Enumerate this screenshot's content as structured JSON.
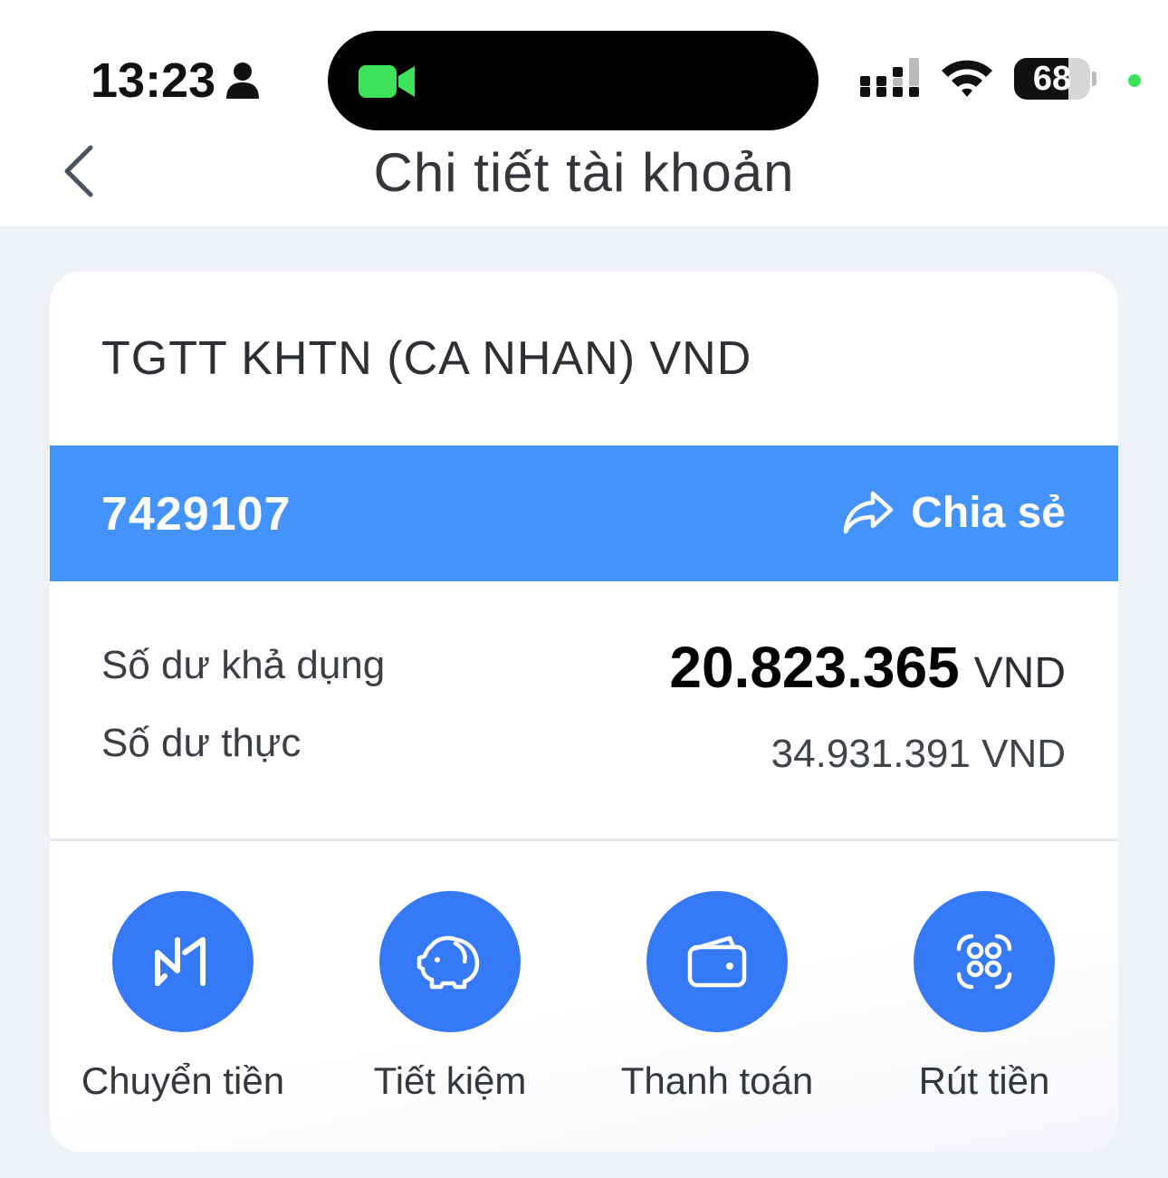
{
  "status_bar": {
    "time": "13:23",
    "battery": "68"
  },
  "header": {
    "title": "Chi tiết tài khoản"
  },
  "account": {
    "name": "TGTT KHTN (CA NHAN) VND",
    "number": "7429107",
    "share_label": "Chia sẻ",
    "available_label": "Số dư khả dụng",
    "available_amount": "20.823.365",
    "available_currency": "VND",
    "actual_label": "Số dư thực",
    "actual_amount": "34.931.391 VND"
  },
  "actions": [
    {
      "label": "Chuyển tiền",
      "icon": "transfer-icon"
    },
    {
      "label": "Tiết kiệm",
      "icon": "piggy-bank-icon"
    },
    {
      "label": "Thanh toán",
      "icon": "wallet-icon"
    },
    {
      "label": "Rút tiền",
      "icon": "qr-scan-icon"
    }
  ],
  "colors": {
    "accent_bar": "#4393fb",
    "action_circle": "#3579f6",
    "facetime_green": "#3ee25a"
  }
}
